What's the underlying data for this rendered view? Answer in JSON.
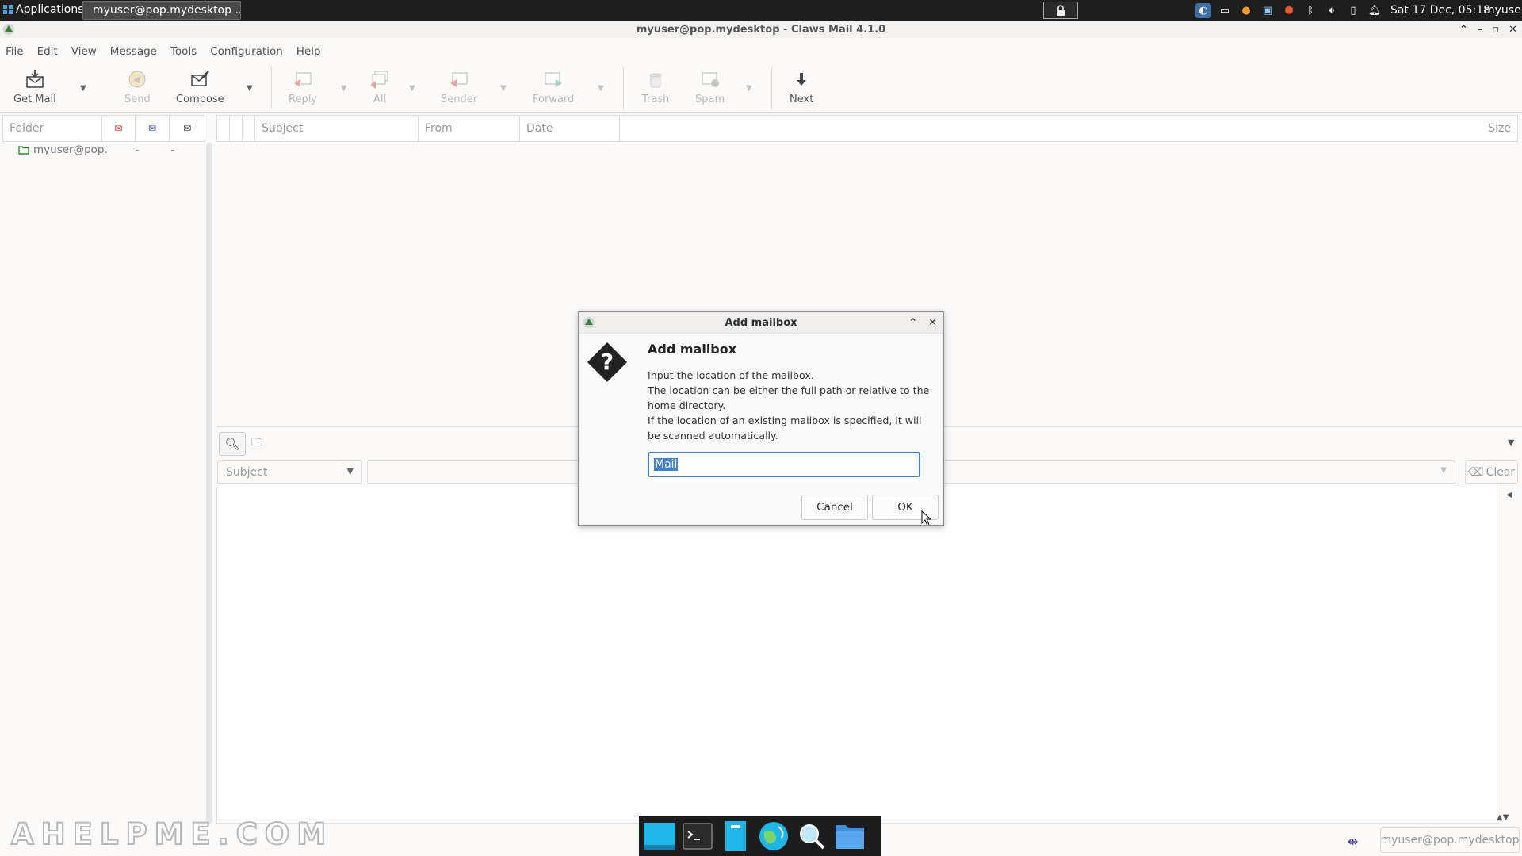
{
  "panel": {
    "applications": "Applications",
    "task_title": "myuser@pop.mydesktop ...",
    "clock": "Sat 17 Dec, 05:18",
    "user": "myuser"
  },
  "window": {
    "title": "myuser@pop.mydesktop - Claws Mail 4.1.0"
  },
  "menu": [
    "File",
    "Edit",
    "View",
    "Message",
    "Tools",
    "Configuration",
    "Help"
  ],
  "toolbar": {
    "get_mail": "Get Mail",
    "send": "Send",
    "compose": "Compose",
    "reply": "Reply",
    "all": "All",
    "sender": "Sender",
    "forward": "Forward",
    "trash": "Trash",
    "spam": "Spam",
    "next": "Next"
  },
  "folder_pane": {
    "header": "Folder",
    "account": "myuser@pop."
  },
  "message_list": {
    "subject": "Subject",
    "from": "From",
    "date": "Date",
    "size": "Size"
  },
  "quicksearch": {
    "type": "Subject",
    "clear": "Clear"
  },
  "status": {
    "account": "myuser@pop.mydesktop"
  },
  "watermark": "AHELPME.COM",
  "dialog": {
    "title": "Add mailbox",
    "heading": "Add mailbox",
    "line1": "Input the location of the mailbox.",
    "line2": "The location can be either the full path or relative to the home directory.",
    "line3": "If the location of an existing mailbox is specified, it will be scanned automatically.",
    "input_value": "Mail",
    "cancel": "Cancel",
    "ok": "OK"
  }
}
